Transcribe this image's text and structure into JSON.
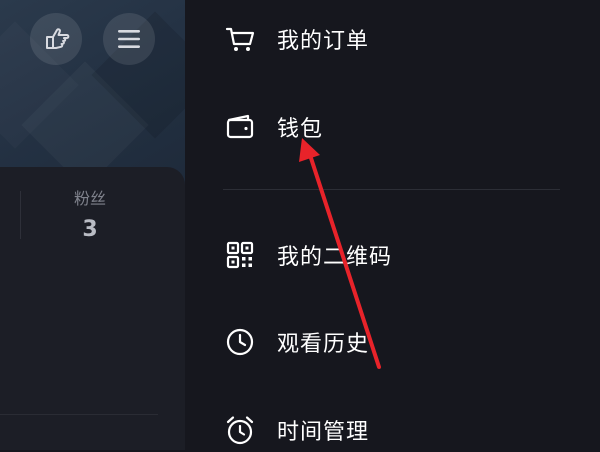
{
  "profile": {
    "fans_label": "粉丝",
    "fans_count": "3"
  },
  "header": {
    "hand_button_icon": "pointing-hand-icon",
    "menu_button_icon": "hamburger-menu-icon"
  },
  "drawer": {
    "items": [
      {
        "label": "我的订单",
        "icon": "cart-icon"
      },
      {
        "label": "钱包",
        "icon": "wallet-icon"
      },
      {
        "label": "我的二维码",
        "icon": "qrcode-icon"
      },
      {
        "label": "观看历史",
        "icon": "clock-icon"
      },
      {
        "label": "时间管理",
        "icon": "alarm-clock-icon"
      }
    ]
  },
  "annotation": {
    "color": "#e8232a",
    "target": "钱包"
  },
  "colors": {
    "drawer_bg": "#16171e",
    "text": "#ffffff",
    "muted_text": "#7f828c"
  }
}
